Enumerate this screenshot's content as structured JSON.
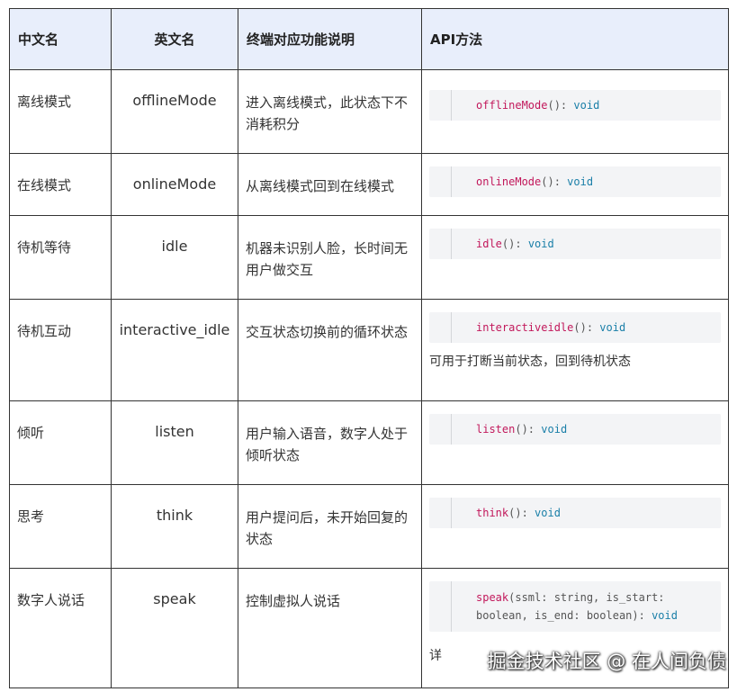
{
  "headers": {
    "cn": "中文名",
    "en": "英文名",
    "desc": "终端对应功能说明",
    "api": "API方法"
  },
  "rows": [
    {
      "cn": "离线模式",
      "en": "offlineMode",
      "desc": "进入离线模式，此状态下不消耗积分",
      "fn": "offlineMode",
      "sig": "(): ",
      "ret": "void"
    },
    {
      "cn": "在线模式",
      "en": "onlineMode",
      "desc": "从离线模式回到在线模式",
      "fn": "onlineMode",
      "sig": "(): ",
      "ret": "void"
    },
    {
      "cn": "待机等待",
      "en": "idle",
      "desc": "机器未识别人脸，长时间无用户做交互",
      "fn": "idle",
      "sig": "(): ",
      "ret": "void"
    },
    {
      "cn": "待机互动",
      "en": "interactive_idle",
      "desc": "交互状态切换前的循环状态",
      "fn": "interactiveidle",
      "sig": "(): ",
      "ret": "void",
      "note": "可用于打断当前状态，回到待机状态"
    },
    {
      "cn": "倾听",
      "en": "listen",
      "desc": "用户输入语音，数字人处于倾听状态",
      "fn": "listen",
      "sig": "(): ",
      "ret": "void"
    },
    {
      "cn": "思考",
      "en": "think",
      "desc": "用户提问后，未开始回复的状态",
      "fn": "think",
      "sig": "(): ",
      "ret": "void"
    },
    {
      "cn": "数字人说话",
      "en": "speak",
      "desc": "控制虚拟人说话",
      "fn": "speak",
      "sig": "(ssml: string, is_start: boolean, is_end: boolean): ",
      "ret": "void",
      "note": "详"
    }
  ],
  "watermark": "掘金技术社区 @ 在人间负债",
  "colors": {
    "header_bg": "#e8eefb",
    "code_bg": "#f3f4f6",
    "fn": "#c2185b",
    "keyword": "#1a7fa8"
  }
}
